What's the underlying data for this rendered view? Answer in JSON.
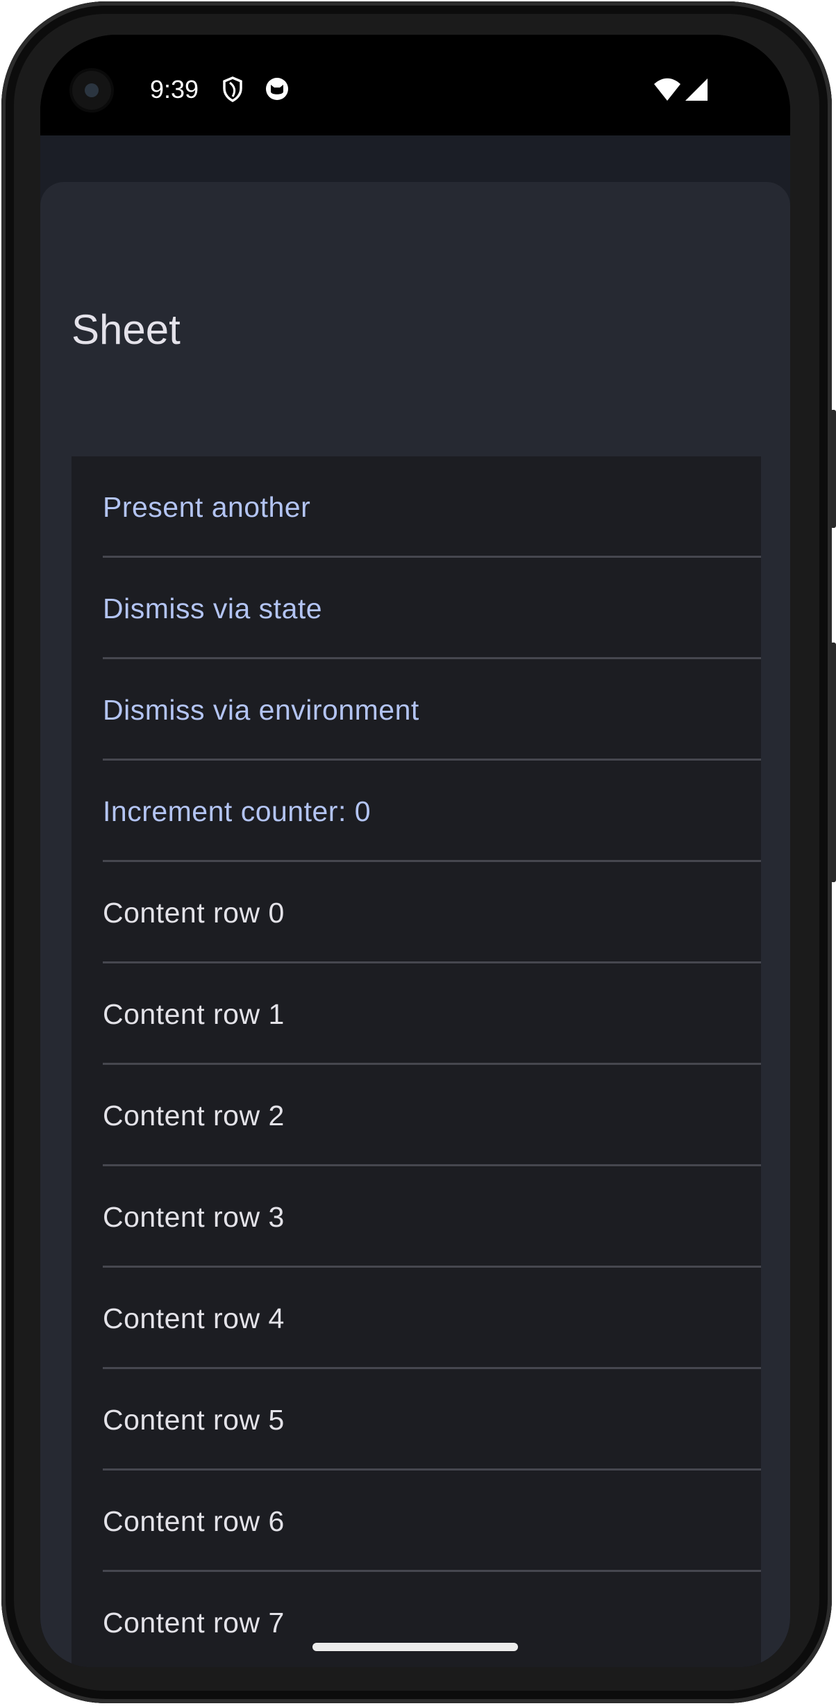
{
  "status_bar": {
    "time": "9:39",
    "icons": [
      "shield-icon",
      "cat-face-icon"
    ],
    "right_icons": [
      "wifi-icon",
      "cellular-signal-icon"
    ]
  },
  "sheet": {
    "title": "Sheet",
    "actions": [
      {
        "label": "Present another"
      },
      {
        "label": "Dismiss via state"
      },
      {
        "label": "Dismiss via environment"
      },
      {
        "label": "Increment counter: 0"
      }
    ],
    "rows": [
      {
        "label": "Content row 0"
      },
      {
        "label": "Content row 1"
      },
      {
        "label": "Content row 2"
      },
      {
        "label": "Content row 3"
      },
      {
        "label": "Content row 4"
      },
      {
        "label": "Content row 5"
      },
      {
        "label": "Content row 6"
      },
      {
        "label": "Content row 7"
      }
    ]
  },
  "colors": {
    "accent": "#b3c4f3",
    "sheet_background": "#262932",
    "list_background": "#1c1d22",
    "text": "#e3e2e8"
  }
}
